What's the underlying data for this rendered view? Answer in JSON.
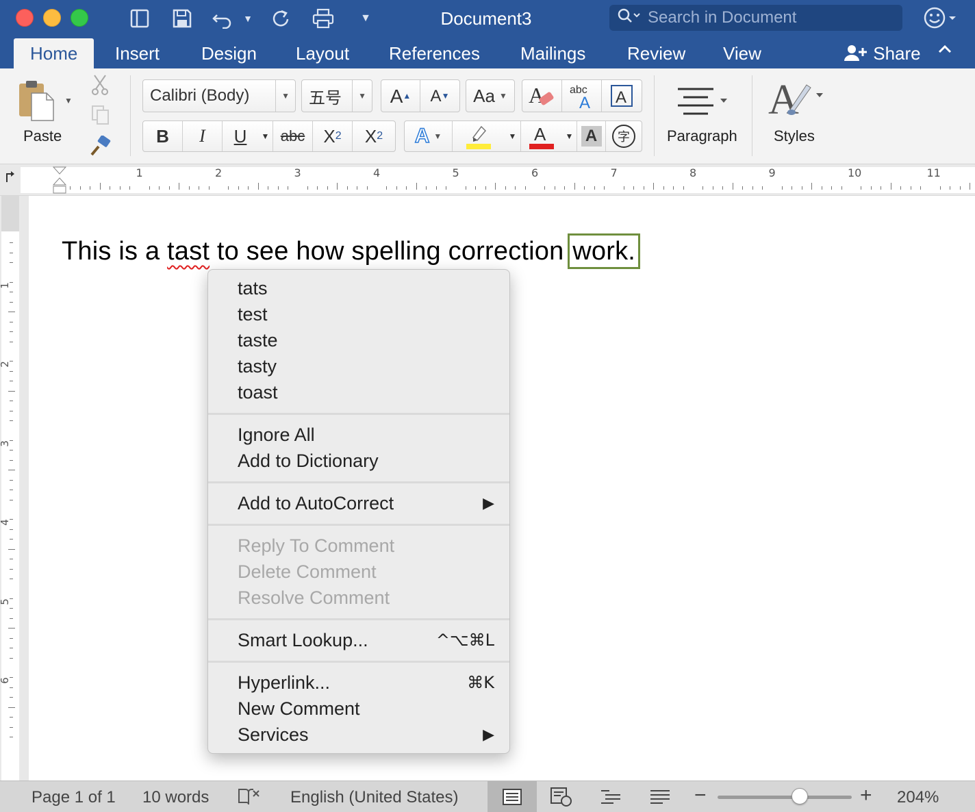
{
  "window": {
    "title": "Document3",
    "search_placeholder": "Search in Document"
  },
  "tabs": [
    {
      "label": "Home",
      "active": true
    },
    {
      "label": "Insert"
    },
    {
      "label": "Design"
    },
    {
      "label": "Layout"
    },
    {
      "label": "References"
    },
    {
      "label": "Mailings"
    },
    {
      "label": "Review"
    },
    {
      "label": "View"
    }
  ],
  "share_label": "Share",
  "ribbon": {
    "paste_label": "Paste",
    "font_name": "Calibri (Body)",
    "font_size": "五号",
    "bold": "B",
    "italic": "I",
    "underline": "U",
    "strike": "abc",
    "phonetic_char": "字",
    "paragraph_label": "Paragraph",
    "styles_label": "Styles"
  },
  "ruler": {
    "numbers": [
      "1",
      "2",
      "3",
      "4",
      "5",
      "6",
      "7",
      "8",
      "9",
      "10",
      "11"
    ],
    "v_numbers": [
      "1",
      "2",
      "3",
      "4",
      "5",
      "6"
    ]
  },
  "document": {
    "before": "This is a ",
    "misspelled": "tast",
    "middle": " to see how spelling correction ",
    "selected": "work."
  },
  "context_menu": {
    "suggestions": [
      "tats",
      "test",
      "taste",
      "tasty",
      "toast"
    ],
    "ignore_all": "Ignore All",
    "add_to_dictionary": "Add to Dictionary",
    "add_to_autocorrect": "Add to AutoCorrect",
    "reply_to_comment": "Reply To Comment",
    "delete_comment": "Delete Comment",
    "resolve_comment": "Resolve Comment",
    "smart_lookup": "Smart Lookup...",
    "smart_lookup_shortcut": "^⌥⌘L",
    "hyperlink": "Hyperlink...",
    "hyperlink_shortcut": "⌘K",
    "new_comment": "New Comment",
    "services": "Services"
  },
  "status": {
    "page": "Page 1 of 1",
    "words": "10 words",
    "language": "English (United States)",
    "zoom": "204%",
    "zoom_level_fraction": 0.6
  },
  "colors": {
    "ribbon_blue": "#2b579a",
    "misspell_red": "#e02020",
    "selection_green": "#6f8f3e"
  }
}
